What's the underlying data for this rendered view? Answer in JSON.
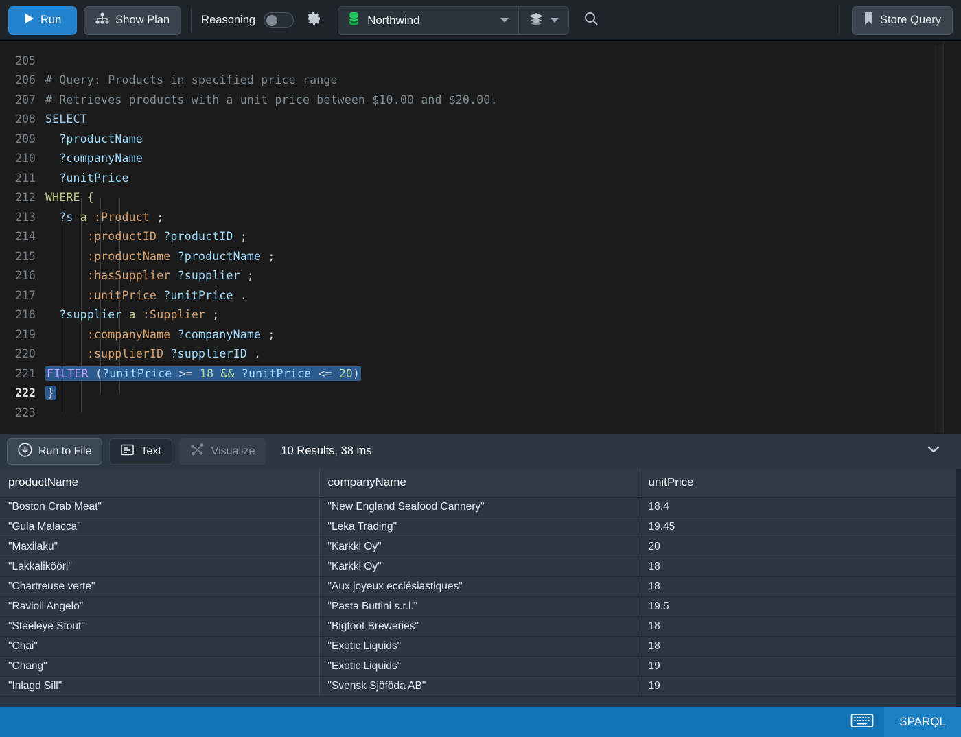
{
  "toolbar": {
    "run_label": "Run",
    "run_icon": "play-icon",
    "show_plan_label": "Show Plan",
    "show_plan_icon": "plan-tree-icon",
    "reasoning_label": "Reasoning",
    "reasoning_enabled": false,
    "settings_icon": "gear-icon",
    "database_name": "Northwind",
    "database_icon": "database-icon",
    "database_icon_color": "#22c55e",
    "layers_icon": "layers-icon",
    "search_icon": "search-icon",
    "store_query_label": "Store Query",
    "store_query_icon": "bookmark-icon",
    "accent_color": "#2383cd"
  },
  "editor": {
    "first_line_number": 205,
    "active_line_number": 222,
    "selected_line_number": 221,
    "lines": [
      {
        "n": 205,
        "text": ""
      },
      {
        "n": 206,
        "text": "# Query: Products in specified price range"
      },
      {
        "n": 207,
        "text": "# Retrieves products with a unit price between $10.00 and $20.00."
      },
      {
        "n": 208,
        "text": "SELECT"
      },
      {
        "n": 209,
        "text": "  ?productName"
      },
      {
        "n": 210,
        "text": "  ?companyName"
      },
      {
        "n": 211,
        "text": "  ?unitPrice"
      },
      {
        "n": 212,
        "text": "WHERE {"
      },
      {
        "n": 213,
        "text": "  ?s a :Product ;"
      },
      {
        "n": 214,
        "text": "      :productID ?productID ;"
      },
      {
        "n": 215,
        "text": "      :productName ?productName ;"
      },
      {
        "n": 216,
        "text": "      :hasSupplier ?supplier ;"
      },
      {
        "n": 217,
        "text": "      :unitPrice ?unitPrice ."
      },
      {
        "n": 218,
        "text": "  ?supplier a :Supplier ;"
      },
      {
        "n": 219,
        "text": "      :companyName ?companyName ;"
      },
      {
        "n": 220,
        "text": "      :supplierID ?supplierID ."
      },
      {
        "n": 221,
        "text": "  FILTER (?unitPrice >= 18 && ?unitPrice <= 20)"
      },
      {
        "n": 222,
        "text": "}"
      },
      {
        "n": 223,
        "text": ""
      }
    ]
  },
  "results_toolbar": {
    "run_to_file_label": "Run to File",
    "run_to_file_icon": "download-circle-icon",
    "text_label": "Text",
    "text_icon": "document-icon",
    "visualize_label": "Visualize",
    "visualize_icon": "graph-nodes-icon",
    "visualize_disabled": true,
    "status": "10 Results,  38 ms",
    "result_count": 10,
    "elapsed": "38 ms",
    "collapse_icon": "chevron-down-icon"
  },
  "results_table": {
    "columns": [
      "productName",
      "companyName",
      "unitPrice"
    ],
    "rows": [
      [
        "\"Boston Crab Meat\"",
        "\"New England Seafood Cannery\"",
        "18.4"
      ],
      [
        "\"Gula Malacca\"",
        "\"Leka Trading\"",
        "19.45"
      ],
      [
        "\"Maxilaku\"",
        "\"Karkki Oy\"",
        "20"
      ],
      [
        "\"Lakkalikööri\"",
        "\"Karkki Oy\"",
        "18"
      ],
      [
        "\"Chartreuse verte\"",
        "\"Aux joyeux ecclésiastiques\"",
        "18"
      ],
      [
        "\"Ravioli Angelo\"",
        "\"Pasta Buttini s.r.l.\"",
        "19.5"
      ],
      [
        "\"Steeleye Stout\"",
        "\"Bigfoot Breweries\"",
        "18"
      ],
      [
        "\"Chai\"",
        "\"Exotic Liquids\"",
        "18"
      ],
      [
        "\"Chang\"",
        "\"Exotic Liquids\"",
        "19"
      ],
      [
        "\"Inlagd Sill\"",
        "\"Svensk Sjöföda AB\"",
        "19"
      ]
    ]
  },
  "statusbar": {
    "keyboard_icon": "keyboard-icon",
    "language": "SPARQL",
    "background_color": "#1272b4"
  }
}
